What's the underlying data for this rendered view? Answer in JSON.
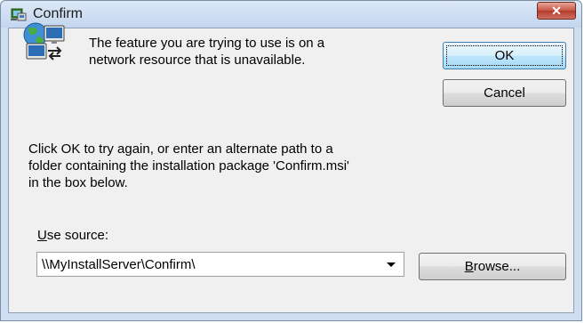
{
  "window": {
    "title": "Confirm"
  },
  "message": {
    "line1": "The feature you are trying to use is on a",
    "line2": "network resource that is unavailable."
  },
  "buttons": {
    "ok_label": "OK",
    "cancel_label": "Cancel",
    "browse_label_access": "B",
    "browse_label_rest": "rowse..."
  },
  "instructions": {
    "line1": "Click OK to try again, or enter an alternate path to a",
    "line2": "folder containing the installation package 'Confirm.msi'",
    "line3": "in the box below."
  },
  "source": {
    "label_access": "U",
    "label_rest": "se source:",
    "value": "\\\\MyInstallServer\\Confirm\\"
  },
  "icons": {
    "title_icon": "installer-icon",
    "message_icon": "network-computer-icon",
    "close_icon": "close-icon",
    "dropdown_icon": "chevron-down-icon"
  },
  "colors": {
    "close_button": "#c75546",
    "default_button_border": "#3c7fb1",
    "client_background": "#f0f0f0",
    "frame": "#cfdff1"
  }
}
